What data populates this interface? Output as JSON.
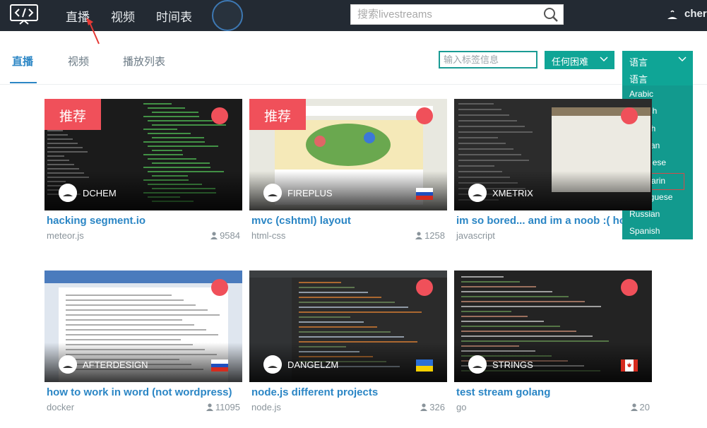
{
  "nav": {
    "links": [
      "直播",
      "视频",
      "时间表"
    ],
    "search_placeholder": "搜索livestreams",
    "user_name": "cher"
  },
  "subtabs": [
    "直播",
    "视频",
    "播放列表"
  ],
  "filters": {
    "tag_placeholder": "输入标签信息",
    "difficulty_label": "任何困难",
    "language_label": "语言",
    "language_options": [
      "语言",
      "Arabic",
      "English",
      "French",
      "German",
      "Japanese",
      "Mandarin",
      "Portuguese",
      "Russian",
      "Spanish"
    ],
    "highlighted_option": "Mandarin"
  },
  "badge_label": "推荐",
  "cards": [
    {
      "title": "hacking segment.io",
      "tag": "meteor.js",
      "viewers": "9584",
      "streamer": "DCHEM",
      "featured": true,
      "flag": "",
      "scene": "code-dark"
    },
    {
      "title": "mvc (cshtml) layout",
      "tag": "html-css",
      "viewers": "1258",
      "streamer": "FIREPLUS",
      "featured": true,
      "flag": "ru",
      "scene": "web"
    },
    {
      "title": "im so bored... and im a noob :( holy t",
      "tag": "javascript",
      "viewers": "",
      "streamer": "XMETRIX",
      "featured": false,
      "flag": "",
      "scene": "desktop"
    },
    {
      "title": "how to work in word (not wordpress)",
      "tag": "docker",
      "viewers": "11095",
      "streamer": "AFTERDESIGN",
      "featured": false,
      "flag": "ru",
      "scene": "word"
    },
    {
      "title": "node.js different projects",
      "tag": "node.js",
      "viewers": "326",
      "streamer": "DANGELZM",
      "featured": false,
      "flag": "ua",
      "scene": "ide"
    },
    {
      "title": "test stream golang",
      "tag": "go",
      "viewers": "20",
      "streamer": "STRINGS",
      "featured": false,
      "flag": "ca",
      "scene": "code-dark2"
    }
  ],
  "colors": {
    "accent": "#2b86c5",
    "teal": "#0fa596",
    "live": "#f0505a",
    "navbar": "#232a33"
  }
}
